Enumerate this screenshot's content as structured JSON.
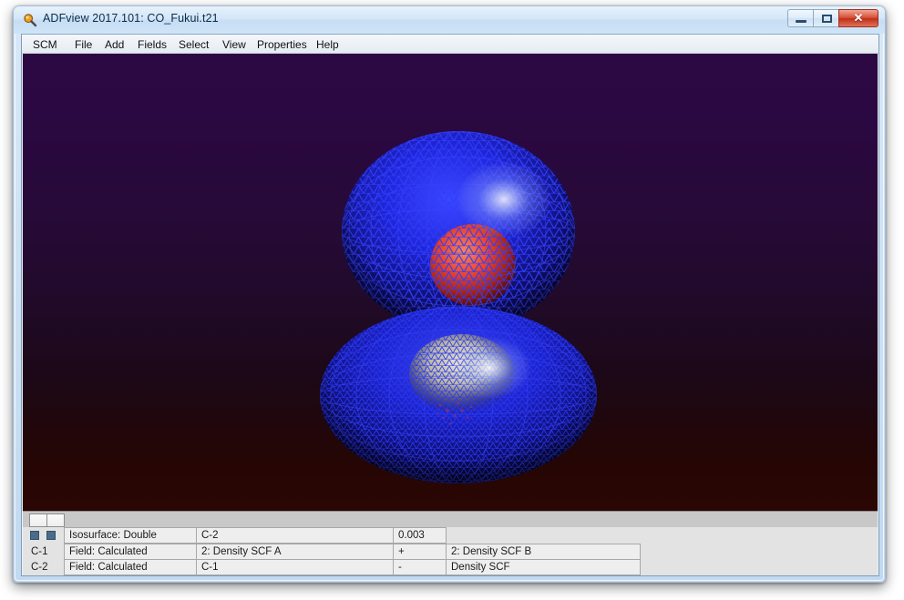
{
  "window": {
    "title": "ADFview 2017.101: CO_Fukui.t21",
    "icon": "magnifier-icon",
    "controls": {
      "minimize": "–",
      "maximize": "□",
      "close": "✕"
    }
  },
  "menu": {
    "items": [
      {
        "label": "SCM"
      },
      {
        "label": "File"
      },
      {
        "label": "Add"
      },
      {
        "label": "Fields"
      },
      {
        "label": "Select"
      },
      {
        "label": "View"
      },
      {
        "label": "Properties"
      },
      {
        "label": "Help"
      }
    ]
  },
  "viewport": {
    "description": "3D isosurface rendering of a CO Fukui function",
    "background_top": "#2a0840",
    "background_bottom": "#2b0604",
    "mesh_color": "#1b2fe8",
    "positive_lobe_color": "#f04a28",
    "highlight_color": "#d8d2a8"
  },
  "toolbar": {
    "tabs": [
      {
        "name": "tab-1"
      },
      {
        "name": "tab-2"
      }
    ]
  },
  "details": {
    "rows": [
      {
        "label": "",
        "checkboxes": 2,
        "type": "Isosurface: Double",
        "source": "C-2",
        "operator": "0.003",
        "second_source": ""
      },
      {
        "label": "C-1",
        "checkboxes": 0,
        "type": "Field: Calculated",
        "source": "2: Density SCF A",
        "operator": "+",
        "second_source": "2: Density SCF B"
      },
      {
        "label": "C-2",
        "checkboxes": 0,
        "type": "Field: Calculated",
        "source": "C-1",
        "operator": "-",
        "second_source": "Density SCF"
      }
    ]
  }
}
